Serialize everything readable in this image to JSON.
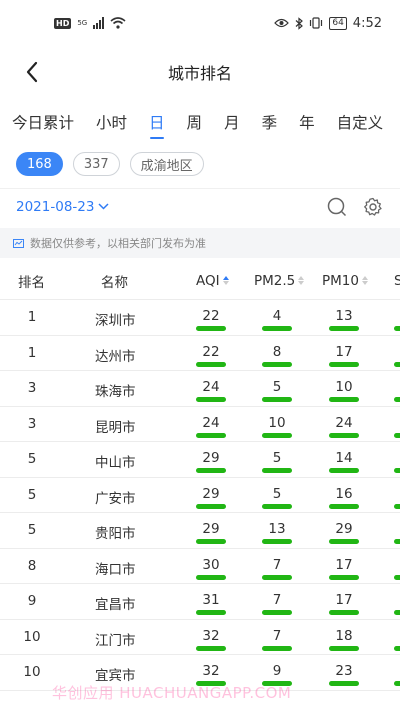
{
  "status_bar": {
    "hd": "HD",
    "network": "5G",
    "battery": "64",
    "time": "4:52"
  },
  "header": {
    "title": "城市排名"
  },
  "period_tabs": [
    {
      "label": "今日累计",
      "active": false
    },
    {
      "label": "小时",
      "active": false
    },
    {
      "label": "日",
      "active": true
    },
    {
      "label": "周",
      "active": false
    },
    {
      "label": "月",
      "active": false
    },
    {
      "label": "季",
      "active": false
    },
    {
      "label": "年",
      "active": false
    },
    {
      "label": "自定义",
      "active": false
    }
  ],
  "filter_chips": [
    {
      "label": "168",
      "active": true
    },
    {
      "label": "337",
      "active": false
    },
    {
      "label": "成渝地区",
      "active": false
    }
  ],
  "date": {
    "value": "2021-08-23"
  },
  "notice": {
    "text": "数据仅供参考，以相关部门发布为准"
  },
  "table": {
    "columns": [
      "排名",
      "名称",
      "AQI",
      "PM2.5",
      "PM10",
      "S"
    ],
    "sorted_column": "AQI",
    "good_color": "#21b614",
    "rows": [
      {
        "rank": "1",
        "name": "深圳市",
        "aqi": "22",
        "pm25": "4",
        "pm10": "13"
      },
      {
        "rank": "1",
        "name": "达州市",
        "aqi": "22",
        "pm25": "8",
        "pm10": "17"
      },
      {
        "rank": "3",
        "name": "珠海市",
        "aqi": "24",
        "pm25": "5",
        "pm10": "10"
      },
      {
        "rank": "3",
        "name": "昆明市",
        "aqi": "24",
        "pm25": "10",
        "pm10": "24"
      },
      {
        "rank": "5",
        "name": "中山市",
        "aqi": "29",
        "pm25": "5",
        "pm10": "14"
      },
      {
        "rank": "5",
        "name": "广安市",
        "aqi": "29",
        "pm25": "5",
        "pm10": "16"
      },
      {
        "rank": "5",
        "name": "贵阳市",
        "aqi": "29",
        "pm25": "13",
        "pm10": "29"
      },
      {
        "rank": "8",
        "name": "海口市",
        "aqi": "30",
        "pm25": "7",
        "pm10": "17"
      },
      {
        "rank": "9",
        "name": "宜昌市",
        "aqi": "31",
        "pm25": "7",
        "pm10": "17"
      },
      {
        "rank": "10",
        "name": "江门市",
        "aqi": "32",
        "pm25": "7",
        "pm10": "18"
      },
      {
        "rank": "10",
        "name": "宜宾市",
        "aqi": "32",
        "pm25": "9",
        "pm10": "23"
      }
    ]
  },
  "watermark": "华创应用 HUACHUANGAPP.COM"
}
